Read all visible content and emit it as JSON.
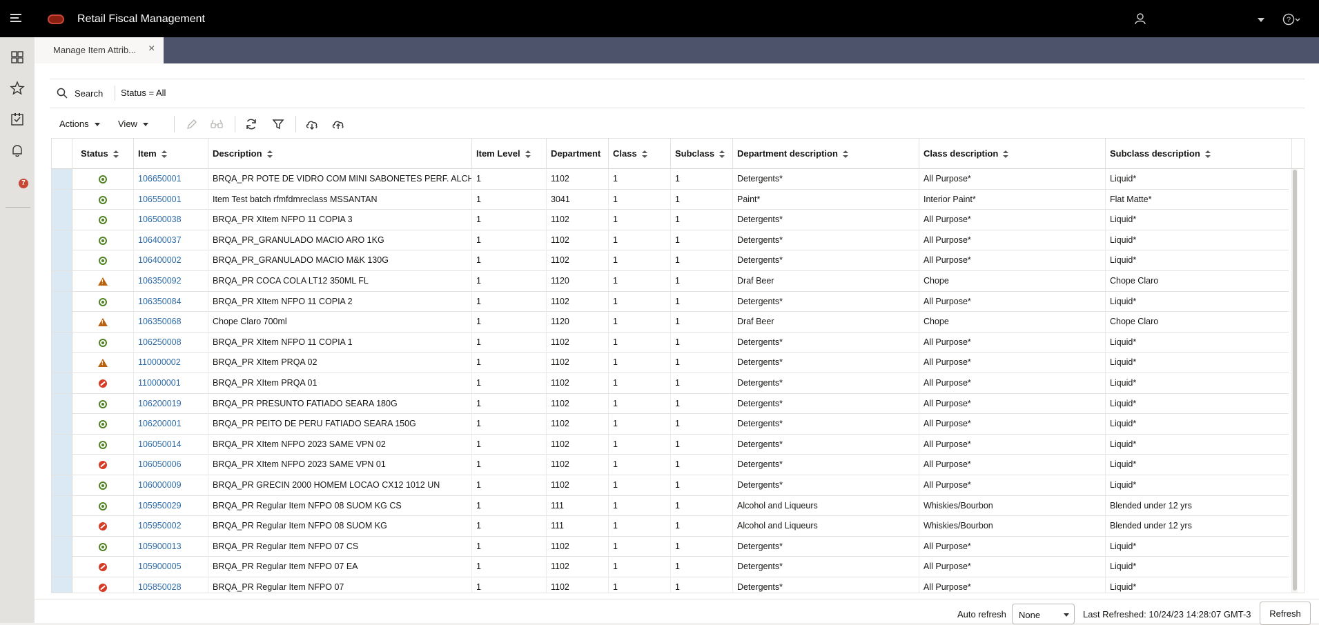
{
  "app": {
    "title": "Retail Fiscal Management",
    "notifications_count": "7"
  },
  "tabs": [
    {
      "label": "Manage Item Attrib...",
      "close": "×"
    }
  ],
  "search": {
    "label": "Search",
    "filter": "Status = All"
  },
  "toolbar": {
    "actions_label": "Actions",
    "view_label": "View"
  },
  "table": {
    "columns": [
      "Status",
      "Item",
      "Description",
      "Item Level",
      "Department",
      "Class",
      "Subclass",
      "Department description",
      "Class description",
      "Subclass description"
    ],
    "rows": [
      {
        "status": "active",
        "item": "106650001",
        "description": "BRQA_PR POTE DE VIDRO COM MINI SABONETES PERF. ALCHEMY",
        "level": "1",
        "dept": "1102",
        "class": "1",
        "subclass": "1",
        "dept_desc": "Detergents*",
        "class_desc": "All Purpose*",
        "subclass_desc": "Liquid*"
      },
      {
        "status": "active",
        "item": "106550001",
        "description": "Item Test batch rfmfdmreclass MSSANTAN",
        "level": "1",
        "dept": "3041",
        "class": "1",
        "subclass": "1",
        "dept_desc": "Paint*",
        "class_desc": "Interior Paint*",
        "subclass_desc": "Flat Matte*"
      },
      {
        "status": "active",
        "item": "106500038",
        "description": "BRQA_PR XItem NFPO 11 COPIA 3",
        "level": "1",
        "dept": "1102",
        "class": "1",
        "subclass": "1",
        "dept_desc": "Detergents*",
        "class_desc": "All Purpose*",
        "subclass_desc": "Liquid*"
      },
      {
        "status": "active",
        "item": "106400037",
        "description": "BRQA_PR_GRANULADO MACIO ARO 1KG",
        "level": "1",
        "dept": "1102",
        "class": "1",
        "subclass": "1",
        "dept_desc": "Detergents*",
        "class_desc": "All Purpose*",
        "subclass_desc": "Liquid*"
      },
      {
        "status": "active",
        "item": "106400002",
        "description": "BRQA_PR_GRANULADO MACIO M&K 130G",
        "level": "1",
        "dept": "1102",
        "class": "1",
        "subclass": "1",
        "dept_desc": "Detergents*",
        "class_desc": "All Purpose*",
        "subclass_desc": "Liquid*"
      },
      {
        "status": "warning",
        "item": "106350092",
        "description": "BRQA_PR COCA COLA LT12 350ML FL",
        "level": "1",
        "dept": "1120",
        "class": "1",
        "subclass": "1",
        "dept_desc": "Draf Beer",
        "class_desc": "Chope",
        "subclass_desc": "Chope Claro"
      },
      {
        "status": "active",
        "item": "106350084",
        "description": "BRQA_PR XItem NFPO 11 COPIA 2",
        "level": "1",
        "dept": "1102",
        "class": "1",
        "subclass": "1",
        "dept_desc": "Detergents*",
        "class_desc": "All Purpose*",
        "subclass_desc": "Liquid*"
      },
      {
        "status": "warning",
        "item": "106350068",
        "description": "Chope Claro 700ml",
        "level": "1",
        "dept": "1120",
        "class": "1",
        "subclass": "1",
        "dept_desc": "Draf Beer",
        "class_desc": "Chope",
        "subclass_desc": "Chope Claro"
      },
      {
        "status": "active",
        "item": "106250008",
        "description": "BRQA_PR XItem NFPO 11 COPIA 1",
        "level": "1",
        "dept": "1102",
        "class": "1",
        "subclass": "1",
        "dept_desc": "Detergents*",
        "class_desc": "All Purpose*",
        "subclass_desc": "Liquid*"
      },
      {
        "status": "warning",
        "item": "110000002",
        "description": "BRQA_PR XItem PRQA 02",
        "level": "1",
        "dept": "1102",
        "class": "1",
        "subclass": "1",
        "dept_desc": "Detergents*",
        "class_desc": "All Purpose*",
        "subclass_desc": "Liquid*"
      },
      {
        "status": "error",
        "item": "110000001",
        "description": "BRQA_PR XItem PRQA 01",
        "level": "1",
        "dept": "1102",
        "class": "1",
        "subclass": "1",
        "dept_desc": "Detergents*",
        "class_desc": "All Purpose*",
        "subclass_desc": "Liquid*"
      },
      {
        "status": "active",
        "item": "106200019",
        "description": "BRQA_PR PRESUNTO FATIADO SEARA 180G",
        "level": "1",
        "dept": "1102",
        "class": "1",
        "subclass": "1",
        "dept_desc": "Detergents*",
        "class_desc": "All Purpose*",
        "subclass_desc": "Liquid*"
      },
      {
        "status": "active",
        "item": "106200001",
        "description": "BRQA_PR PEITO DE PERU FATIADO SEARA 150G",
        "level": "1",
        "dept": "1102",
        "class": "1",
        "subclass": "1",
        "dept_desc": "Detergents*",
        "class_desc": "All Purpose*",
        "subclass_desc": "Liquid*"
      },
      {
        "status": "active",
        "item": "106050014",
        "description": "BRQA_PR XItem NFPO 2023 SAME VPN 02",
        "level": "1",
        "dept": "1102",
        "class": "1",
        "subclass": "1",
        "dept_desc": "Detergents*",
        "class_desc": "All Purpose*",
        "subclass_desc": "Liquid*"
      },
      {
        "status": "error",
        "item": "106050006",
        "description": "BRQA_PR XItem NFPO 2023 SAME VPN 01",
        "level": "1",
        "dept": "1102",
        "class": "1",
        "subclass": "1",
        "dept_desc": "Detergents*",
        "class_desc": "All Purpose*",
        "subclass_desc": "Liquid*"
      },
      {
        "status": "active",
        "item": "106000009",
        "description": "BRQA_PR GRECIN 2000 HOMEM LOCAO CX12 1012 UN",
        "level": "1",
        "dept": "1102",
        "class": "1",
        "subclass": "1",
        "dept_desc": "Detergents*",
        "class_desc": "All Purpose*",
        "subclass_desc": "Liquid*"
      },
      {
        "status": "active",
        "item": "105950029",
        "description": "BRQA_PR Regular Item NFPO 08 SUOM KG CS",
        "level": "1",
        "dept": "111",
        "class": "1",
        "subclass": "1",
        "dept_desc": "Alcohol and Liqueurs",
        "class_desc": "Whiskies/Bourbon",
        "subclass_desc": "Blended under 12 yrs"
      },
      {
        "status": "error",
        "item": "105950002",
        "description": "BRQA_PR Regular Item NFPO 08 SUOM KG",
        "level": "1",
        "dept": "111",
        "class": "1",
        "subclass": "1",
        "dept_desc": "Alcohol and Liqueurs",
        "class_desc": "Whiskies/Bourbon",
        "subclass_desc": "Blended under 12 yrs"
      },
      {
        "status": "active",
        "item": "105900013",
        "description": "BRQA_PR Regular Item NFPO 07 CS",
        "level": "1",
        "dept": "1102",
        "class": "1",
        "subclass": "1",
        "dept_desc": "Detergents*",
        "class_desc": "All Purpose*",
        "subclass_desc": "Liquid*"
      },
      {
        "status": "error",
        "item": "105900005",
        "description": "BRQA_PR Regular Item NFPO 07 EA",
        "level": "1",
        "dept": "1102",
        "class": "1",
        "subclass": "1",
        "dept_desc": "Detergents*",
        "class_desc": "All Purpose*",
        "subclass_desc": "Liquid*"
      },
      {
        "status": "error",
        "item": "105850028",
        "description": "BRQA_PR Regular Item NFPO 07",
        "level": "1",
        "dept": "1102",
        "class": "1",
        "subclass": "1",
        "dept_desc": "Detergents*",
        "class_desc": "All Purpose*",
        "subclass_desc": "Liquid*"
      }
    ]
  },
  "footer": {
    "auto_refresh_label": "Auto refresh",
    "auto_refresh_value": "None",
    "last_refreshed": "Last Refreshed: 10/24/23 14:28:07 GMT-3",
    "refresh_label": "Refresh"
  },
  "colors": {
    "status_active": "#508223",
    "status_warning": "#b8620f",
    "status_error": "#d63b25",
    "link": "#2d6ba8",
    "topbar": "#000000",
    "tabbar": "#4d536b"
  }
}
